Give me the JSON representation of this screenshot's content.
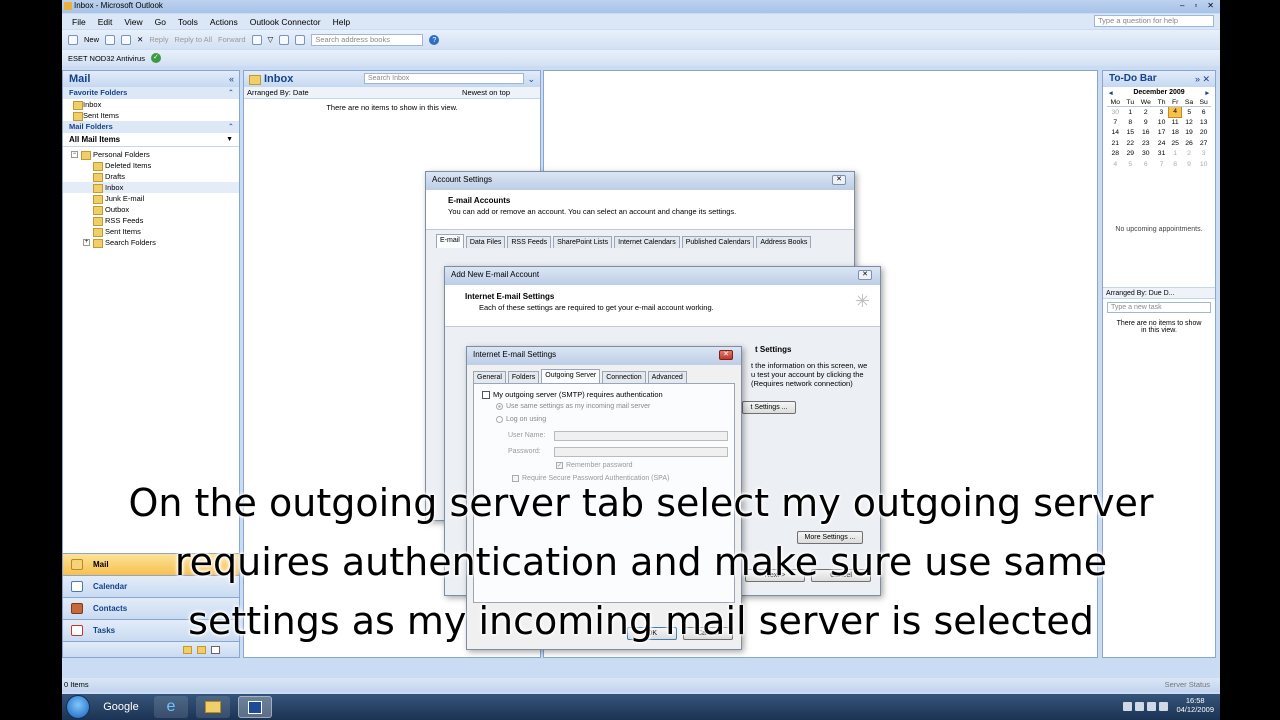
{
  "window": {
    "title": "Inbox - Microsoft Outlook",
    "min": "–",
    "max": "▫",
    "close": "✕"
  },
  "menu": [
    "File",
    "Edit",
    "View",
    "Go",
    "Tools",
    "Actions",
    "Outlook Connector",
    "Help"
  ],
  "help_placeholder": "Type a question for help",
  "toolbar": {
    "new": "New",
    "reply": "Reply",
    "reply_all": "Reply to All",
    "forward": "Forward",
    "search_book": "Search address books"
  },
  "toolbar2": {
    "eset": "ESET NOD32 Antivirus"
  },
  "nav": {
    "title": "Mail",
    "favorites_title": "Favorite Folders",
    "favorites": [
      "Inbox",
      "Sent Items"
    ],
    "mail_folders_title": "Mail Folders",
    "all_mail": "All Mail Items",
    "root": "Personal Folders",
    "folders": [
      "Deleted Items",
      "Drafts",
      "Inbox",
      "Junk E-mail",
      "Outbox",
      "RSS Feeds",
      "Sent Items"
    ],
    "search_folders": "Search Folders",
    "buttons": [
      "Mail",
      "Calendar",
      "Contacts",
      "Tasks"
    ]
  },
  "inbox": {
    "title": "Inbox",
    "search": "Search Inbox",
    "arranged": "Arranged By: Date",
    "sort": "Newest on top",
    "empty": "There are no items to show in this view."
  },
  "todo": {
    "title": "To-Do Bar",
    "month": "December 2009",
    "weekdays": [
      "Mo",
      "Tu",
      "We",
      "Th",
      "Fr",
      "Sa",
      "Su"
    ],
    "weeks": [
      [
        "30",
        "1",
        "2",
        "3",
        "4",
        "5",
        "6"
      ],
      [
        "7",
        "8",
        "9",
        "10",
        "11",
        "12",
        "13"
      ],
      [
        "14",
        "15",
        "16",
        "17",
        "18",
        "19",
        "20"
      ],
      [
        "21",
        "22",
        "23",
        "24",
        "25",
        "26",
        "27"
      ],
      [
        "28",
        "29",
        "30",
        "31",
        "1",
        "2",
        "3"
      ],
      [
        "4",
        "5",
        "6",
        "7",
        "8",
        "9",
        "10"
      ]
    ],
    "today": "4",
    "no_appt": "No upcoming appointments.",
    "tasks_arranged": "Arranged By: Due D...",
    "new_task": "Type a new task",
    "tasks_empty": "There are no items to show in this view."
  },
  "status": {
    "items": "0 Items",
    "server": "Server Status"
  },
  "account_settings": {
    "title": "Account Settings",
    "heading": "E-mail Accounts",
    "desc": "You can add or remove an account. You can select an account and change its settings.",
    "tabs": [
      "E-mail",
      "Data Files",
      "RSS Feeds",
      "SharePoint Lists",
      "Internet Calendars",
      "Published Calendars",
      "Address Books"
    ]
  },
  "add_account": {
    "title": "Add New E-mail Account",
    "heading": "Internet E-mail Settings",
    "desc": "Each of these settings are required to get your e-mail account working.",
    "side_heading": "t Settings",
    "side_text": "t the information on this screen, we\nu test your account by clicking the\n(Requires network connection)",
    "test_btn": "t Settings ...",
    "more_btn": "More Settings ...",
    "next_btn": "Next >",
    "cancel_btn": "Cancel"
  },
  "inet_settings": {
    "title": "Internet E-mail Settings",
    "tabs": [
      "General",
      "Folders",
      "Outgoing Server",
      "Connection",
      "Advanced"
    ],
    "active_tab": "Outgoing Server",
    "smtp_auth": "My outgoing server (SMTP) requires authentication",
    "use_same": "Use same settings as my incoming mail server",
    "log_on": "Log on using",
    "user_label": "User Name:",
    "pass_label": "Password:",
    "remember": "Remember password",
    "spa": "Require Secure Password Authentication (SPA)",
    "ok": "OK",
    "cancel": "Cancel"
  },
  "caption": {
    "line1": "On the outgoing server tab select my outgoing server",
    "line2": "requires authentication and make sure use same",
    "line3": "settings as my incoming mail server is selected"
  },
  "taskbar": {
    "google": "Google",
    "time": "16:58",
    "date": "04/12/2009"
  }
}
